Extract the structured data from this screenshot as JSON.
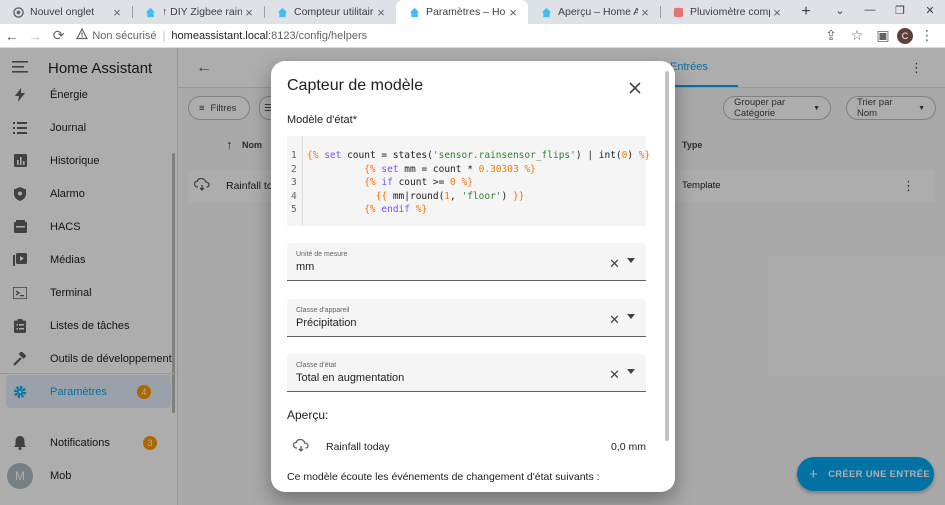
{
  "browser": {
    "tabs": [
      {
        "title": "Nouvel onglet",
        "icon": "chrome-icon",
        "active": false
      },
      {
        "title": "↑ DIY Zigbee rain gaug",
        "icon": "ha-icon",
        "active": false
      },
      {
        "title": "Compteur utilitaire - H",
        "icon": "ha-icon",
        "active": false
      },
      {
        "title": "Paramètres – Home Ass",
        "icon": "ha-icon",
        "active": true
      },
      {
        "title": "Aperçu – Home Assista",
        "icon": "ha-icon",
        "active": false
      },
      {
        "title": "Pluviomètre compatibl",
        "icon": "puzzle-icon",
        "active": false
      }
    ],
    "address": {
      "security": "Non sécurisé",
      "host": "homeassistant.local",
      "path": ":8123/config/helpers"
    },
    "profile_initial": "C"
  },
  "sidebar": {
    "title": "Home Assistant",
    "items": [
      {
        "label": "Énergie",
        "icon": "lightning-icon"
      },
      {
        "label": "Journal",
        "icon": "list-icon"
      },
      {
        "label": "Historique",
        "icon": "chart-bar-icon"
      },
      {
        "label": "Alarmo",
        "icon": "shield-icon"
      },
      {
        "label": "HACS",
        "icon": "hacs-icon"
      },
      {
        "label": "Médias",
        "icon": "play-box-icon"
      },
      {
        "label": "Terminal",
        "icon": "console-icon"
      },
      {
        "label": "Listes de tâches",
        "icon": "clipboard-list-icon"
      },
      {
        "label": "Outils de développement",
        "icon": "hammer-icon"
      },
      {
        "label": "Paramètres",
        "icon": "gear-icon",
        "badge": "4",
        "selected": true
      }
    ],
    "notifications": {
      "label": "Notifications",
      "badge": "3"
    },
    "user": {
      "initial": "M",
      "name": "Mob"
    }
  },
  "main": {
    "tab_label": "Entrées",
    "filters_label": "Filtres",
    "group_by_label": "Grouper par Catégorie",
    "sort_label": "Trier par Nom",
    "columns": {
      "name": "Nom",
      "type": "Type"
    },
    "row": {
      "name": "Rainfall to",
      "type": "Template"
    },
    "fab_label": "CRÉER UNE ENTRÉE"
  },
  "dialog": {
    "title": "Capteur de modèle",
    "template_label": "Modèle d'état*",
    "code_lines": [
      "1",
      "2",
      "3",
      "4",
      "5"
    ],
    "unit": {
      "label": "Unité de mesure",
      "value": "mm"
    },
    "device_class": {
      "label": "Classe d'appareil",
      "value": "Précipitation"
    },
    "state_class": {
      "label": "Classe d'état",
      "value": "Total en augmentation"
    },
    "preview_title": "Aperçu:",
    "preview": {
      "name": "Rainfall today",
      "value": "0,0 mm"
    },
    "listen_text": "Ce modèle écoute les événements de changement d'état suivants :"
  },
  "colors": {
    "accent": "#03a9f4",
    "badge": "#ff9800"
  }
}
